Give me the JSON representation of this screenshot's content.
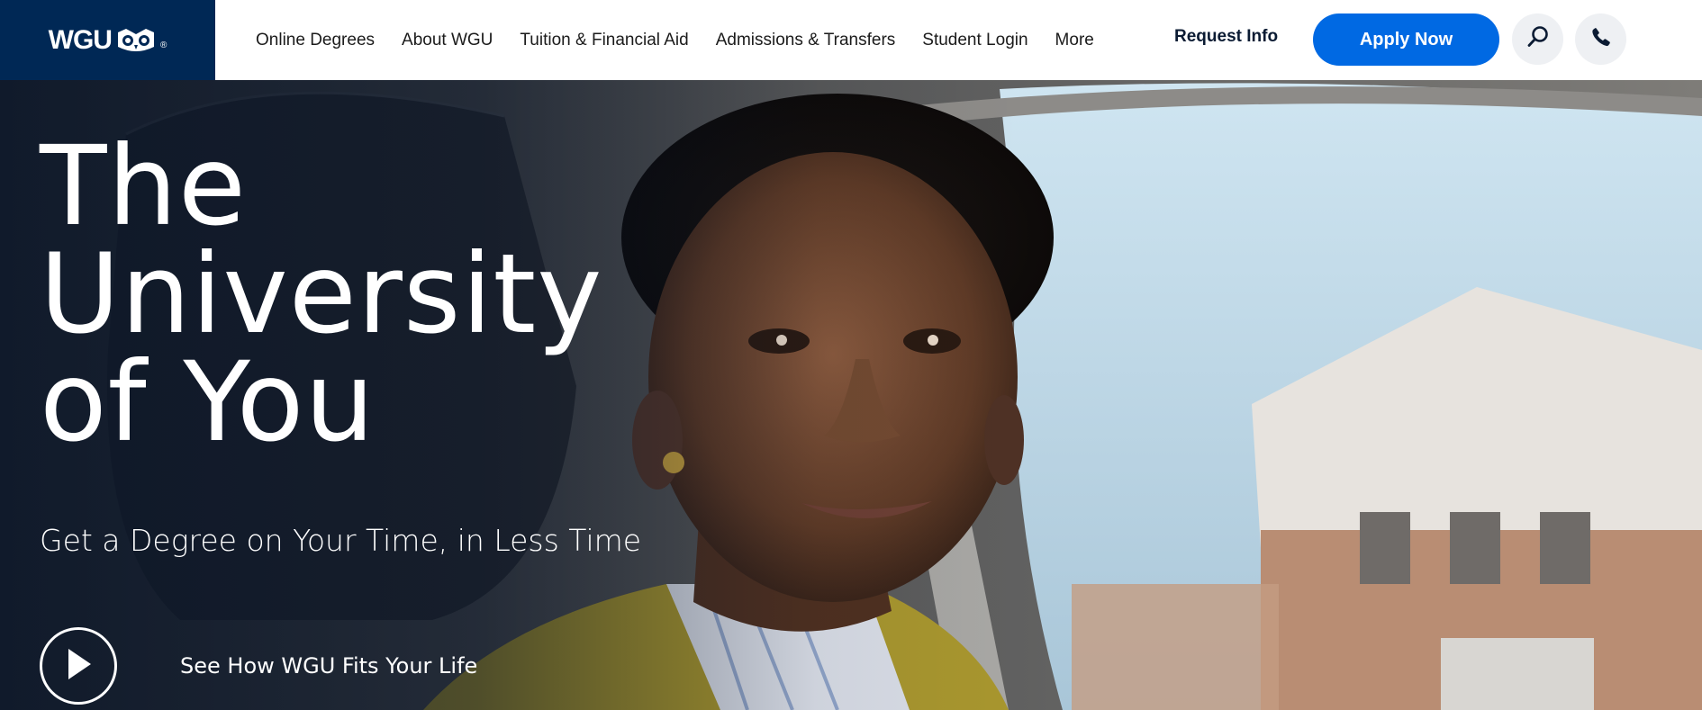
{
  "header": {
    "logo": {
      "text": "WGU",
      "registered": "®",
      "icon": "owl-icon"
    },
    "nav": [
      {
        "label": "Online Degrees"
      },
      {
        "label": "About WGU"
      },
      {
        "label": "Tuition & Financial Aid"
      },
      {
        "label": "Admissions & Transfers"
      },
      {
        "label": "Student Login"
      },
      {
        "label": "More"
      }
    ],
    "request_info_label": "Request Info",
    "apply_label": "Apply Now",
    "search_icon": "search-icon",
    "phone_icon": "phone-icon"
  },
  "hero": {
    "title_lines": [
      "The",
      "University",
      "of You"
    ],
    "subtitle": "Get a Degree on Your Time, in Less Time",
    "video_label": "See How WGU Fits Your Life",
    "play_icon": "play-icon"
  },
  "colors": {
    "brand_navy": "#002855",
    "apply_blue": "#0069e3",
    "icon_button_bg": "#eef0f3",
    "text_dark": "#1b1b1b"
  }
}
